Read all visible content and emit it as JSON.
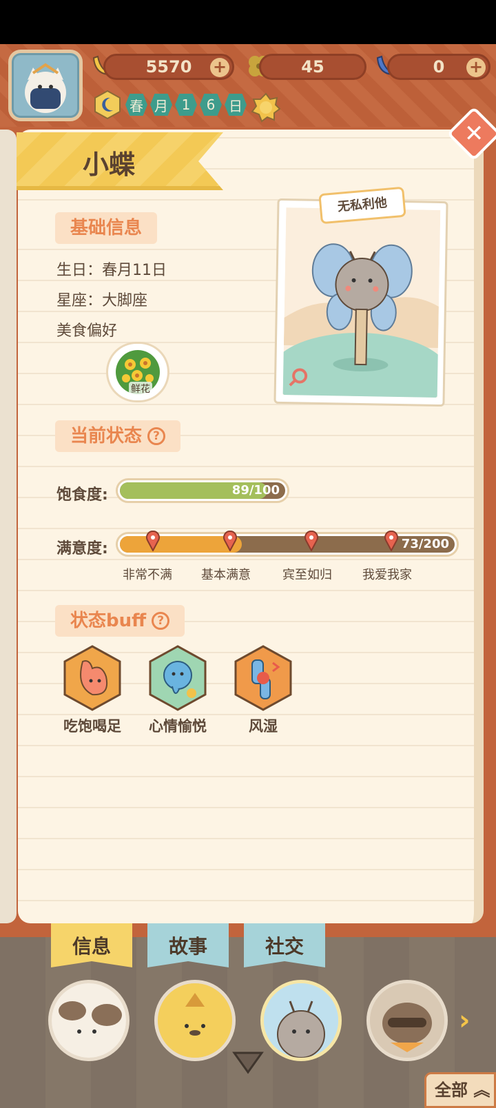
{
  "header": {
    "currencies": [
      {
        "icon": "banana-icon",
        "value": "5570"
      },
      {
        "icon": "clover-icon",
        "value": "45"
      },
      {
        "icon": "blue-banana-icon",
        "value": "0"
      }
    ],
    "plus_label": "+",
    "date": [
      "春",
      "月",
      "1",
      "6",
      "日"
    ]
  },
  "character": {
    "name": "小蝶",
    "trait": "无私利他"
  },
  "basic_info": {
    "section_title": "基础信息",
    "birthday": "生日：春月11日",
    "constellation": "星座：大脚座",
    "food_pref_label": "美食偏好",
    "food_item": "鲜花"
  },
  "status": {
    "section_title": "当前状态",
    "help": "?",
    "satiety_label": "饱食度:",
    "satiety_text": "89/100",
    "satiety_value": 89,
    "satiety_max": 100,
    "satisfaction_label": "满意度:",
    "satisfaction_text": "73/200",
    "satisfaction_value": 73,
    "satisfaction_max": 200,
    "milestones": [
      "非常不满",
      "基本满意",
      "宾至如归",
      "我爱我家"
    ]
  },
  "buffs": {
    "section_title": "状态buff",
    "help": "?",
    "items": [
      {
        "label": "吃饱喝足",
        "icon": "stomach-icon"
      },
      {
        "label": "心情愉悦",
        "icon": "happy-spirit-icon"
      },
      {
        "label": "风湿",
        "icon": "rheumatism-icon"
      }
    ]
  },
  "tabs": [
    "信息",
    "故事",
    "社交"
  ],
  "bottom": {
    "all_label": "全部",
    "next_arrow": "›"
  },
  "colors": {
    "satiety_fill": "#a4bf5c",
    "satisfaction_fill": "#eda43a",
    "accent": "#e9864f"
  }
}
